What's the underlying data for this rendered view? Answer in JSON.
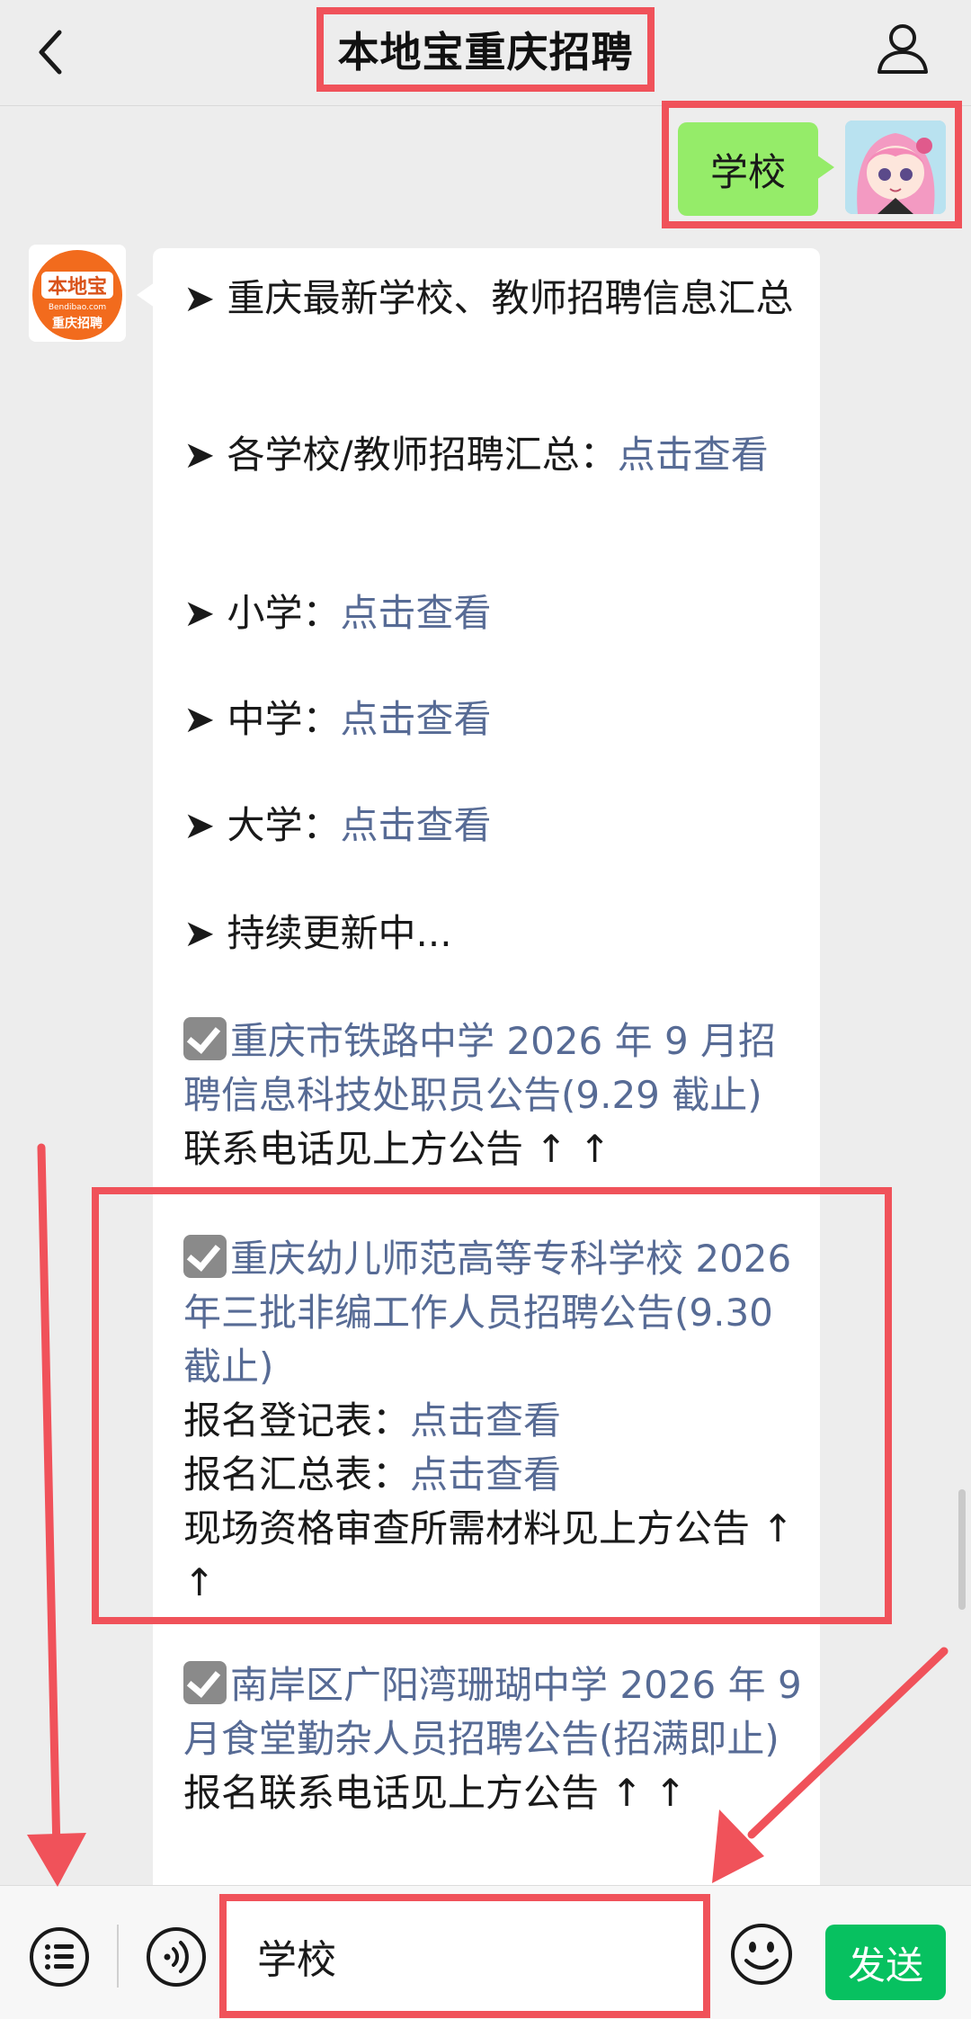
{
  "header": {
    "title": "本地宝重庆招聘"
  },
  "me_message": {
    "text": "学校"
  },
  "bot": {
    "logo_text": "本地宝",
    "logo_sub": "Bendibao.com",
    "logo_label": "重庆招聘"
  },
  "messages": {
    "m1": "➤ 重庆最新学校、教师招聘信息汇总",
    "m2_prefix": "➤ 各学校/教师招聘汇总：",
    "m2_link": "点击查看",
    "m3_prefix": "➤ 小学：",
    "m3_link": "点击查看",
    "m4_prefix": "➤ 中学：",
    "m4_link": "点击查看",
    "m5_prefix": "➤ 大学：",
    "m5_link": "点击查看",
    "m6": "➤ 持续更新中...",
    "item1_title": "重庆市铁路中学 2026 年 9 月招聘信息科技处职员公告(9.29 截止)",
    "item1_note": "联系电话见上方公告 ↑ ↑",
    "item2_title": "重庆幼儿师范高等专科学校 2026 年三批非编工作人员招聘公告(9.30 截止)",
    "item2_form1_prefix": "报名登记表：",
    "item2_form1_link": "点击查看",
    "item2_form2_prefix": "报名汇总表：",
    "item2_form2_link": "点击查看",
    "item2_note": "现场资格审查所需材料见上方公告 ↑ ↑",
    "item3_title": "南岸区广阳湾珊瑚中学 2026 年 9 月食堂勤杂人员招聘公告(招满即止)",
    "item3_note": "报名联系电话见上方公告 ↑ ↑"
  },
  "input_bar": {
    "value": "学校",
    "send_label": "发送"
  },
  "colors": {
    "highlight": "#f0525a",
    "my_bubble": "#95ec69",
    "link": "#576b95",
    "send": "#07c160"
  }
}
